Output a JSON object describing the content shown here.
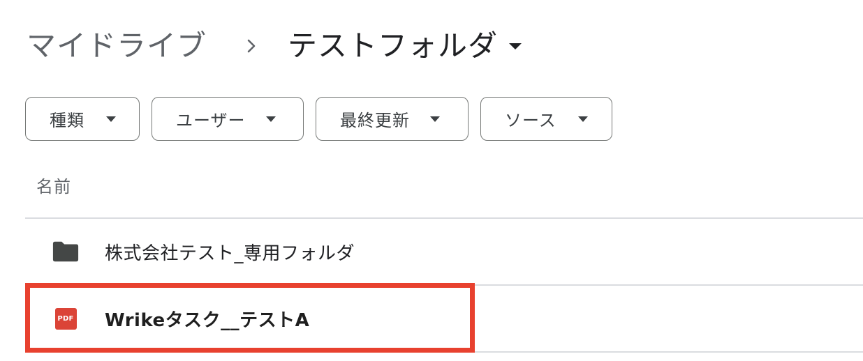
{
  "breadcrumb": {
    "root": "マイドライブ",
    "separator_icon": "chevron-right-icon",
    "current": "テストフォルダ",
    "current_caret_icon": "arrow-drop-down-icon"
  },
  "filters": [
    {
      "label": "種類"
    },
    {
      "label": "ユーザー"
    },
    {
      "label": "最終更新"
    },
    {
      "label": "ソース"
    }
  ],
  "list": {
    "column_header": "名前",
    "rows": [
      {
        "name": "株式会社テスト_専用フォルダ",
        "icon": "folder-icon"
      },
      {
        "name": "Wrikeタスク__テストA",
        "icon": "pdf-icon",
        "icon_text": "PDF"
      }
    ]
  },
  "colors": {
    "highlight": "#e8412f",
    "pdf": "#db4437",
    "folder": "#444746"
  }
}
